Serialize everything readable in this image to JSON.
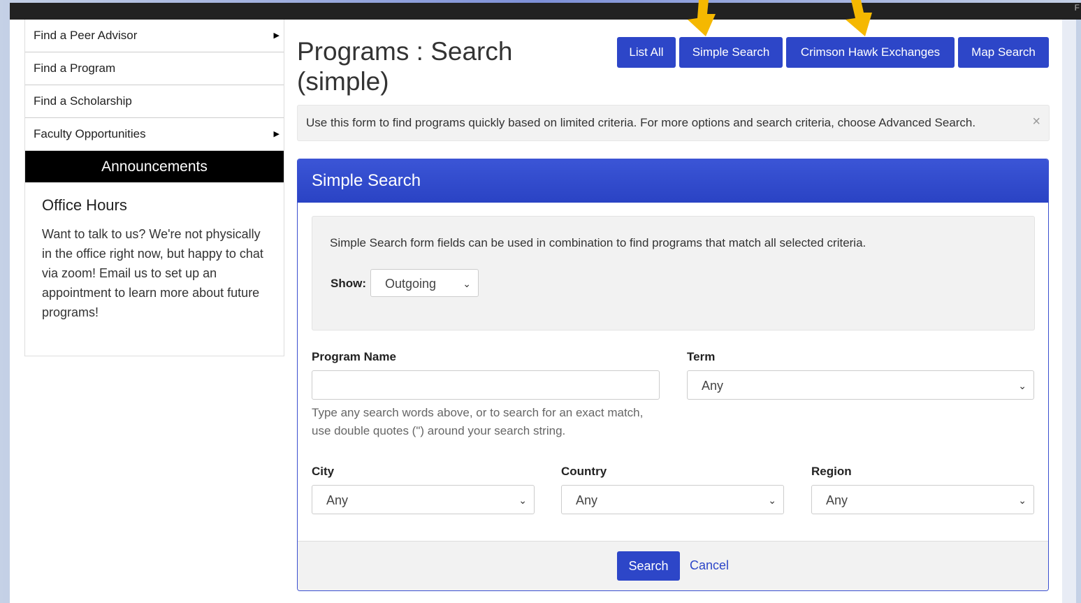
{
  "topbar": {
    "corner_text": "F"
  },
  "sidebar": {
    "items": [
      {
        "label": "Find a Peer Advisor",
        "has_submenu": true
      },
      {
        "label": "Find a Program",
        "has_submenu": false
      },
      {
        "label": "Find a Scholarship",
        "has_submenu": false
      },
      {
        "label": "Faculty Opportunities",
        "has_submenu": true
      }
    ],
    "announcements": {
      "header": "Announcements",
      "title": "Office Hours",
      "body": "Want to talk to us? We're not physically in the office right now, but happy to chat via zoom! Email us to set up an appointment to learn more about future programs!"
    }
  },
  "main": {
    "title": "Programs : Search (simple)",
    "buttons": {
      "list_all": "List All",
      "simple_search": "Simple Search",
      "crimson_hawk": "Crimson Hawk Exchanges",
      "map_search": "Map Search"
    },
    "alert": {
      "text": "Use this form to find programs quickly based on limited criteria. For more options and search criteria, choose Advanced Search.",
      "close": "×"
    },
    "panel": {
      "heading": "Simple Search",
      "intro": "Simple Search form fields can be used in combination to find programs that match all selected criteria.",
      "show_label": "Show:",
      "show_value": "Outgoing",
      "program_name_label": "Program Name",
      "program_name_value": "",
      "program_name_help": "Type any search words above, or to search for an exact match, use double quotes (\") around your search string.",
      "term_label": "Term",
      "term_value": "Any",
      "city_label": "City",
      "city_value": "Any",
      "country_label": "Country",
      "country_value": "Any",
      "region_label": "Region",
      "region_value": "Any",
      "search_button": "Search",
      "cancel_link": "Cancel"
    }
  },
  "colors": {
    "primary": "#2d46c8",
    "annotation_arrow": "#f5b800"
  },
  "icons": {
    "caret": "caret-right-icon",
    "chevron": "chevron-down-icon",
    "close": "close-icon"
  }
}
